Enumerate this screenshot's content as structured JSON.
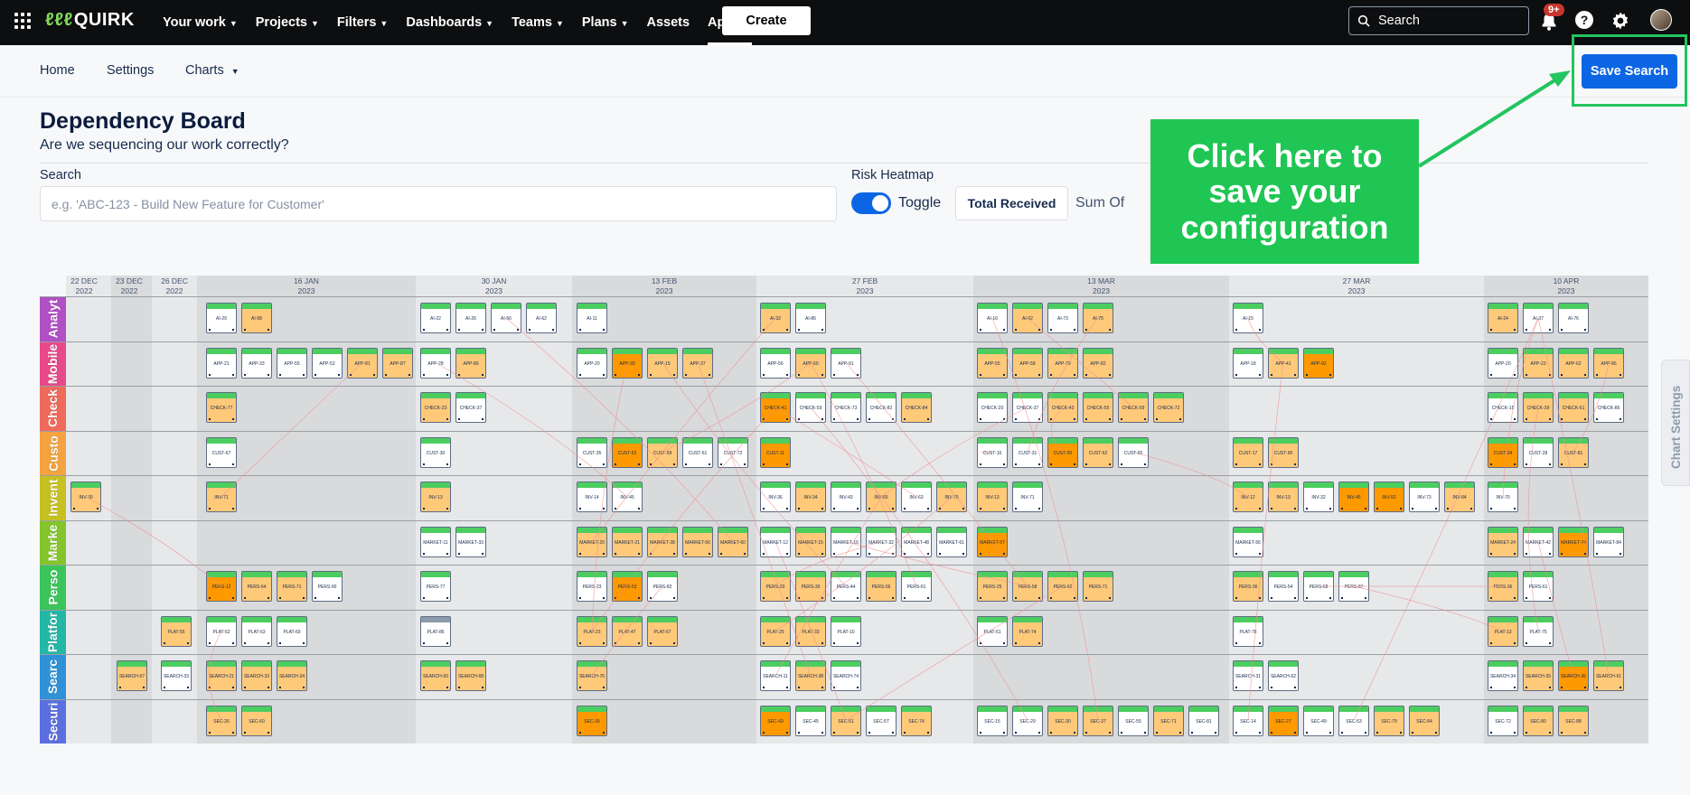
{
  "topnav": {
    "logo": "QUIRK",
    "logo_mark": "ℓℓℓ",
    "items": [
      {
        "label": "Your work",
        "chevron": true,
        "active": false
      },
      {
        "label": "Projects",
        "chevron": true,
        "active": false
      },
      {
        "label": "Filters",
        "chevron": true,
        "active": false
      },
      {
        "label": "Dashboards",
        "chevron": true,
        "active": false
      },
      {
        "label": "Teams",
        "chevron": true,
        "active": false
      },
      {
        "label": "Plans",
        "chevron": true,
        "active": false
      },
      {
        "label": "Assets",
        "chevron": false,
        "active": false
      },
      {
        "label": "Apps",
        "chevron": true,
        "active": true
      }
    ],
    "create_label": "Create",
    "search_label": "Search",
    "notification_badge": "9+",
    "help_label": "?"
  },
  "subnav": {
    "home": "Home",
    "settings": "Settings",
    "charts": "Charts",
    "save_search": "Save Search"
  },
  "page": {
    "title": "Dependency Board",
    "subtitle": "Are we sequencing our work correctly?",
    "search_label": "Search",
    "search_placeholder": "e.g. 'ABC-123 - Build New Feature for Customer'",
    "heatmap_label": "Risk Heatmap",
    "toggle_label": "Toggle",
    "total_received": "Total Received",
    "sum_of": "Sum Of"
  },
  "callout": {
    "text": "Click here to save your configuration",
    "color": "#1fc653"
  },
  "side_tab": "Chart Settings",
  "board": {
    "timeline": [
      {
        "day": "22 DEC",
        "year": "2022"
      },
      {
        "day": "23 DEC",
        "year": "2022"
      },
      {
        "day": "26 DEC",
        "year": "2022"
      },
      {
        "day": "16 JAN",
        "year": "2023"
      },
      {
        "day": "30 JAN",
        "year": "2023"
      },
      {
        "day": "13 FEB",
        "year": "2023"
      },
      {
        "day": "27 FEB",
        "year": "2023"
      },
      {
        "day": "13 MAR",
        "year": "2023"
      },
      {
        "day": "27 MAR",
        "year": "2023"
      },
      {
        "day": "10 APR",
        "year": "2023"
      }
    ],
    "lanes": [
      {
        "label": "Analyt",
        "color": "#b14fc5",
        "cards": [
          {
            "id": "AI-29",
            "risk": "none"
          },
          {
            "id": "AI-58",
            "risk": "lo"
          },
          {
            "id": "AI-22",
            "risk": "none"
          },
          {
            "id": "AI-26",
            "risk": "none"
          },
          {
            "id": "AI-56",
            "risk": "none"
          },
          {
            "id": "AI-62",
            "risk": "none"
          },
          {
            "id": "AI-11",
            "risk": "none"
          },
          {
            "id": "AI-32",
            "risk": "lo"
          },
          {
            "id": "AI-86",
            "risk": "none"
          },
          {
            "id": "AI-16",
            "risk": "none"
          },
          {
            "id": "AI-62",
            "risk": "lo"
          },
          {
            "id": "AI-73",
            "risk": "none"
          },
          {
            "id": "AI-75",
            "risk": "lo"
          },
          {
            "id": "AI-15",
            "risk": "none"
          },
          {
            "id": "AI-24",
            "risk": "lo"
          },
          {
            "id": "AI-37",
            "risk": "none"
          },
          {
            "id": "AI-76",
            "risk": "none"
          }
        ]
      },
      {
        "label": "Mobile",
        "color": "#e8498a",
        "cards": [
          {
            "id": "APP-21",
            "risk": "none"
          },
          {
            "id": "APP-33",
            "risk": "none"
          },
          {
            "id": "APP-55",
            "risk": "none"
          },
          {
            "id": "APP-52",
            "risk": "none"
          },
          {
            "id": "APP-81",
            "risk": "lo"
          },
          {
            "id": "APP-87",
            "risk": "lo"
          },
          {
            "id": "APP-28",
            "risk": "none"
          },
          {
            "id": "APP-86",
            "risk": "lo"
          },
          {
            "id": "APP-20",
            "risk": "none"
          },
          {
            "id": "APP-39",
            "risk": "hi"
          },
          {
            "id": "APP-15",
            "risk": "lo"
          },
          {
            "id": "APP-37",
            "risk": "lo"
          },
          {
            "id": "APP-56",
            "risk": "none"
          },
          {
            "id": "APP-60",
            "risk": "lo"
          },
          {
            "id": "APP-91",
            "risk": "none"
          },
          {
            "id": "APP-55",
            "risk": "lo"
          },
          {
            "id": "APP-58",
            "risk": "lo"
          },
          {
            "id": "APP-79",
            "risk": "lo"
          },
          {
            "id": "APP-82",
            "risk": "lo"
          },
          {
            "id": "APP-18",
            "risk": "none"
          },
          {
            "id": "APP-41",
            "risk": "lo"
          },
          {
            "id": "APP-92",
            "risk": "hi"
          },
          {
            "id": "APP-20",
            "risk": "none"
          },
          {
            "id": "APP-23",
            "risk": "lo"
          },
          {
            "id": "APP-62",
            "risk": "lo"
          },
          {
            "id": "APP-86",
            "risk": "lo"
          }
        ]
      },
      {
        "label": "Check",
        "color": "#f06a5c",
        "cards": [
          {
            "id": "CHECK-77",
            "risk": "lo"
          },
          {
            "id": "CHECK-23",
            "risk": "lo"
          },
          {
            "id": "CHECK-37",
            "risk": "none"
          },
          {
            "id": "CHECK-41",
            "risk": "hi"
          },
          {
            "id": "CHECK-59",
            "risk": "none"
          },
          {
            "id": "CHECK-73",
            "risk": "none"
          },
          {
            "id": "CHECK-82",
            "risk": "none"
          },
          {
            "id": "CHECK-84",
            "risk": "lo"
          },
          {
            "id": "CHECK-20",
            "risk": "none"
          },
          {
            "id": "CHECK-37",
            "risk": "none"
          },
          {
            "id": "CHECK-43",
            "risk": "lo"
          },
          {
            "id": "CHECK-55",
            "risk": "lo"
          },
          {
            "id": "CHECK-59",
            "risk": "lo"
          },
          {
            "id": "CHECK-72",
            "risk": "lo"
          },
          {
            "id": "CHECK-15",
            "risk": "none"
          },
          {
            "id": "CHECK-39",
            "risk": "lo"
          },
          {
            "id": "CHECK-61",
            "risk": "lo"
          },
          {
            "id": "CHECK-86",
            "risk": "none"
          }
        ]
      },
      {
        "label": "Custo",
        "color": "#f4a340",
        "cards": [
          {
            "id": "CUST-67",
            "risk": "none"
          },
          {
            "id": "CUST-30",
            "risk": "none"
          },
          {
            "id": "CUST-35",
            "risk": "none"
          },
          {
            "id": "CUST-53",
            "risk": "hi"
          },
          {
            "id": "CUST-59",
            "risk": "lo"
          },
          {
            "id": "CUST-61",
            "risk": "none"
          },
          {
            "id": "CUST-72",
            "risk": "none"
          },
          {
            "id": "CUST-11",
            "risk": "hi"
          },
          {
            "id": "CUST-16",
            "risk": "none"
          },
          {
            "id": "CUST-31",
            "risk": "none"
          },
          {
            "id": "CUST-50",
            "risk": "hi"
          },
          {
            "id": "CUST-62",
            "risk": "lo"
          },
          {
            "id": "CUST-65",
            "risk": "none"
          },
          {
            "id": "CUST-17",
            "risk": "lo"
          },
          {
            "id": "CUST-90",
            "risk": "lo"
          },
          {
            "id": "CUST-24",
            "risk": "hi"
          },
          {
            "id": "CUST-28",
            "risk": "none"
          },
          {
            "id": "CUST-81",
            "risk": "lo"
          }
        ]
      },
      {
        "label": "Invent",
        "color": "#c6c022",
        "cards": [
          {
            "id": "INV-30",
            "risk": "lo"
          },
          {
            "id": "INV-71",
            "risk": "lo"
          },
          {
            "id": "INV-13",
            "risk": "lo"
          },
          {
            "id": "INV-14",
            "risk": "none"
          },
          {
            "id": "INV-45",
            "risk": "none"
          },
          {
            "id": "INV-36",
            "risk": "none"
          },
          {
            "id": "INV-34",
            "risk": "lo"
          },
          {
            "id": "INV-43",
            "risk": "none"
          },
          {
            "id": "INV-65",
            "risk": "lo"
          },
          {
            "id": "INV-63",
            "risk": "none"
          },
          {
            "id": "INV-75",
            "risk": "lo"
          },
          {
            "id": "INV-13",
            "risk": "lo"
          },
          {
            "id": "INV-71",
            "risk": "none"
          },
          {
            "id": "INV-12",
            "risk": "lo"
          },
          {
            "id": "INV-13",
            "risk": "lo"
          },
          {
            "id": "INV-32",
            "risk": "none"
          },
          {
            "id": "INV-45",
            "risk": "hi"
          },
          {
            "id": "INV-52",
            "risk": "hi"
          },
          {
            "id": "INV-73",
            "risk": "none"
          },
          {
            "id": "INV-84",
            "risk": "lo"
          },
          {
            "id": "INV-70",
            "risk": "none"
          }
        ]
      },
      {
        "label": "Marke",
        "color": "#84c52b",
        "cards": [
          {
            "id": "MARKET-11",
            "risk": "none"
          },
          {
            "id": "MARKET-33",
            "risk": "none"
          },
          {
            "id": "MARKET-20",
            "risk": "lo"
          },
          {
            "id": "MARKET-21",
            "risk": "lo"
          },
          {
            "id": "MARKET-38",
            "risk": "lo"
          },
          {
            "id": "MARKET-56",
            "risk": "lo"
          },
          {
            "id": "MARKET-60",
            "risk": "lo"
          },
          {
            "id": "MARKET-12",
            "risk": "none"
          },
          {
            "id": "MARKET-15",
            "risk": "lo"
          },
          {
            "id": "MARKET-16",
            "risk": "none"
          },
          {
            "id": "MARKET-32",
            "risk": "none"
          },
          {
            "id": "MARKET-48",
            "risk": "none"
          },
          {
            "id": "MARKET-61",
            "risk": "none"
          },
          {
            "id": "MARKET-57",
            "risk": "hi"
          },
          {
            "id": "MARKET-56",
            "risk": "none"
          },
          {
            "id": "MARKET-24",
            "risk": "lo"
          },
          {
            "id": "MARKET-42",
            "risk": "none"
          },
          {
            "id": "MARKET-74",
            "risk": "hi"
          },
          {
            "id": "MARKET-84",
            "risk": "none"
          }
        ]
      },
      {
        "label": "Perso",
        "color": "#3ac45a",
        "cards": [
          {
            "id": "PERS-12",
            "risk": "hi"
          },
          {
            "id": "PERS-64",
            "risk": "lo"
          },
          {
            "id": "PERS-71",
            "risk": "lo"
          },
          {
            "id": "PERS-90",
            "risk": "none"
          },
          {
            "id": "PERS-77",
            "risk": "none"
          },
          {
            "id": "PERS-23",
            "risk": "none"
          },
          {
            "id": "PERS-53",
            "risk": "hi"
          },
          {
            "id": "PERS-82",
            "risk": "none"
          },
          {
            "id": "PERS-20",
            "risk": "lo"
          },
          {
            "id": "PERS-30",
            "risk": "lo"
          },
          {
            "id": "PERS-44",
            "risk": "none"
          },
          {
            "id": "PERS-56",
            "risk": "lo"
          },
          {
            "id": "PERS-61",
            "risk": "none"
          },
          {
            "id": "PERS-25",
            "risk": "lo"
          },
          {
            "id": "PERS-58",
            "risk": "lo"
          },
          {
            "id": "PERS-62",
            "risk": "lo"
          },
          {
            "id": "PERS-71",
            "risk": "lo"
          },
          {
            "id": "PERS-36",
            "risk": "lo"
          },
          {
            "id": "PERS-54",
            "risk": "none"
          },
          {
            "id": "PERS-68",
            "risk": "none"
          },
          {
            "id": "PERS-87",
            "risk": "none"
          },
          {
            "id": "PERS-36",
            "risk": "lo"
          },
          {
            "id": "PERS-61",
            "risk": "none"
          }
        ]
      },
      {
        "label": "Platfor",
        "color": "#23b8a6",
        "cards": [
          {
            "id": "PLAT-55",
            "risk": "lo"
          },
          {
            "id": "PLAT-52",
            "risk": "none"
          },
          {
            "id": "PLAT-63",
            "risk": "none"
          },
          {
            "id": "PLAT-69",
            "risk": "none"
          },
          {
            "id": "PLAT-86",
            "risk": "none",
            "gray": true
          },
          {
            "id": "PLAT-23",
            "risk": "lo"
          },
          {
            "id": "PLAT-47",
            "risk": "lo"
          },
          {
            "id": "PLAT-67",
            "risk": "lo"
          },
          {
            "id": "PLAT-25",
            "risk": "lo"
          },
          {
            "id": "PLAT-33",
            "risk": "lo"
          },
          {
            "id": "PLAT-10",
            "risk": "none"
          },
          {
            "id": "PLAT-61",
            "risk": "none"
          },
          {
            "id": "PLAT-74",
            "risk": "lo"
          },
          {
            "id": "PLAT-78",
            "risk": "none"
          },
          {
            "id": "PLAT-13",
            "risk": "lo"
          },
          {
            "id": "PLAT-75",
            "risk": "none"
          }
        ]
      },
      {
        "label": "Searc",
        "color": "#2f92d8",
        "cards": [
          {
            "id": "SEARCH-67",
            "risk": "lo"
          },
          {
            "id": "SEARCH-33",
            "risk": "none"
          },
          {
            "id": "SEARCH-21",
            "risk": "lo"
          },
          {
            "id": "SEARCH-33",
            "risk": "lo"
          },
          {
            "id": "SEARCH-34",
            "risk": "lo"
          },
          {
            "id": "SEARCH-60",
            "risk": "lo"
          },
          {
            "id": "SEARCH-68",
            "risk": "lo"
          },
          {
            "id": "SEARCH-76",
            "risk": "lo"
          },
          {
            "id": "SEARCH-11",
            "risk": "none"
          },
          {
            "id": "SEARCH-38",
            "risk": "lo"
          },
          {
            "id": "SEARCH-74",
            "risk": "none"
          },
          {
            "id": "SEARCH-31",
            "risk": "none"
          },
          {
            "id": "SEARCH-62",
            "risk": "none"
          },
          {
            "id": "SEARCH-34",
            "risk": "none"
          },
          {
            "id": "SEARCH-35",
            "risk": "lo"
          },
          {
            "id": "SEARCH-36",
            "risk": "hi"
          },
          {
            "id": "SEARCH-61",
            "risk": "lo"
          }
        ]
      },
      {
        "label": "Securi",
        "color": "#5b6fe0",
        "cards": [
          {
            "id": "SEC-26",
            "risk": "lo"
          },
          {
            "id": "SEC-60",
            "risk": "lo"
          },
          {
            "id": "SEC-35",
            "risk": "hi"
          },
          {
            "id": "SEC-43",
            "risk": "hi"
          },
          {
            "id": "SEC-45",
            "risk": "none"
          },
          {
            "id": "SEC-51",
            "risk": "lo"
          },
          {
            "id": "SEC-57",
            "risk": "none"
          },
          {
            "id": "SEC-74",
            "risk": "lo"
          },
          {
            "id": "SEC-15",
            "risk": "none"
          },
          {
            "id": "SEC-29",
            "risk": "none"
          },
          {
            "id": "SEC-30",
            "risk": "lo"
          },
          {
            "id": "SEC-37",
            "risk": "lo"
          },
          {
            "id": "SEC-55",
            "risk": "none"
          },
          {
            "id": "SEC-71",
            "risk": "lo"
          },
          {
            "id": "SEC-81",
            "risk": "none"
          },
          {
            "id": "SEC-14",
            "risk": "none"
          },
          {
            "id": "SEC-27",
            "risk": "hi"
          },
          {
            "id": "SEC-49",
            "risk": "none"
          },
          {
            "id": "SEC-53",
            "risk": "none"
          },
          {
            "id": "SEC-79",
            "risk": "lo"
          },
          {
            "id": "SEC-84",
            "risk": "lo"
          },
          {
            "id": "SEC-72",
            "risk": "none"
          },
          {
            "id": "SEC-80",
            "risk": "lo"
          },
          {
            "id": "SEC-88",
            "risk": "lo"
          }
        ]
      }
    ]
  }
}
